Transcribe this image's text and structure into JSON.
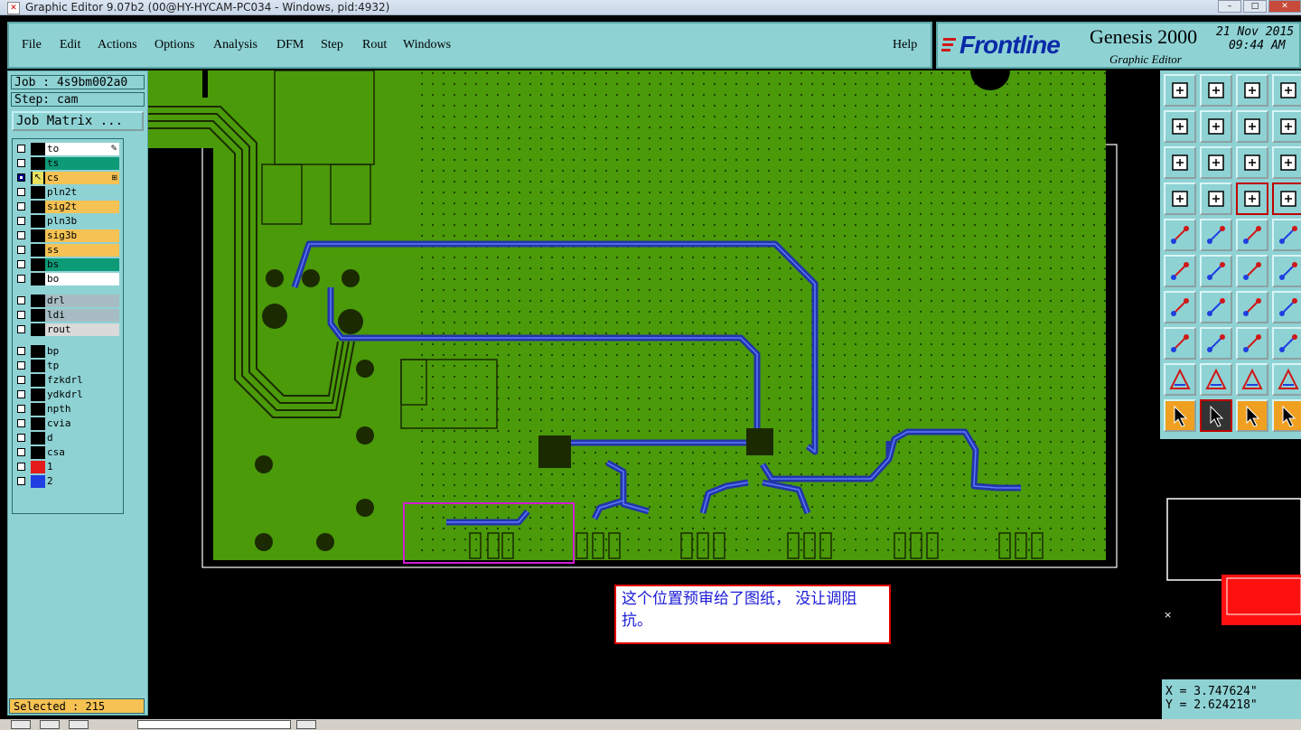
{
  "window": {
    "title": "Graphic Editor 9.07b2 (00@HY-HYCAM-PC034 - Windows, pid:4932)"
  },
  "menu": {
    "items": [
      "File",
      "Edit",
      "Actions",
      "Options",
      "Analysis",
      "DFM",
      "Step",
      "Rout",
      "Windows"
    ],
    "help": "Help"
  },
  "branding": {
    "logo": "Frontline",
    "product": "Genesis 2000",
    "subtitle": "Graphic Editor",
    "date": "21 Nov 2015",
    "time": "09:44 AM"
  },
  "job": {
    "job_line": "Job : 4s9bm002a0",
    "step_line": "Step: cam",
    "matrix_button": "Job Matrix ..."
  },
  "layers": [
    {
      "name": "to",
      "color": "#ffffff",
      "swatch": "#000000",
      "affected": false,
      "marker": "pencil"
    },
    {
      "name": "ts",
      "color": "#0d9a77",
      "swatch": "#000000",
      "affected": false
    },
    {
      "name": "cs",
      "color": "#f5c253",
      "swatch": "#000000",
      "affected": true,
      "marker": "arrow"
    },
    {
      "name": "pln2t",
      "color": "#8ed2d4",
      "swatch": "#000000",
      "affected": false
    },
    {
      "name": "sig2t",
      "color": "#f5c253",
      "swatch": "#000000",
      "affected": false
    },
    {
      "name": "pln3b",
      "color": "#8ed2d4",
      "swatch": "#000000",
      "affected": false
    },
    {
      "name": "sig3b",
      "color": "#f5c253",
      "swatch": "#000000",
      "affected": false
    },
    {
      "name": "ss",
      "color": "#f5c253",
      "swatch": "#000000",
      "affected": false
    },
    {
      "name": "bs",
      "color": "#0d9a77",
      "swatch": "#000000",
      "affected": false
    },
    {
      "name": "bo",
      "color": "#ffffff",
      "swatch": "#000000",
      "affected": false
    },
    {
      "name": "drl",
      "color": "#a7bcc2",
      "swatch": "#000000",
      "affected": false
    },
    {
      "name": "ldi",
      "color": "#a7bcc2",
      "swatch": "#000000",
      "affected": false
    },
    {
      "name": "rout",
      "color": "#dadada",
      "swatch": "#000000",
      "affected": false
    },
    {
      "name": "bp",
      "color": "#8ed2d4",
      "swatch": "#000000",
      "affected": false
    },
    {
      "name": "tp",
      "color": "#8ed2d4",
      "swatch": "#000000",
      "affected": false
    },
    {
      "name": "fzkdrl",
      "color": "#8ed2d4",
      "swatch": "#000000",
      "affected": false
    },
    {
      "name": "ydkdrl",
      "color": "#8ed2d4",
      "swatch": "#000000",
      "affected": false
    },
    {
      "name": "npth",
      "color": "#8ed2d4",
      "swatch": "#000000",
      "affected": false
    },
    {
      "name": "cvia",
      "color": "#8ed2d4",
      "swatch": "#000000",
      "affected": false
    },
    {
      "name": "d",
      "color": "#8ed2d4",
      "swatch": "#000000",
      "affected": false
    },
    {
      "name": "csa",
      "color": "#8ed2d4",
      "swatch": "#000000",
      "affected": false
    },
    {
      "name": "1",
      "color": "#8ed2d4",
      "swatch": "#e41b1b",
      "affected": false
    },
    {
      "name": "2",
      "color": "#8ed2d4",
      "swatch": "#1f3fe0",
      "affected": false
    }
  ],
  "status": {
    "selected": "Selected : 215"
  },
  "annotation": {
    "text": "这个位置预审给了图纸， 没让调阻抗。"
  },
  "coords": {
    "x": "X = 3.747624\"",
    "y": "Y = 2.624218\""
  },
  "colors": {
    "board_green": "#4a9a0a",
    "trace_blue": "#3a56d8",
    "panel_cyan": "#8ed2d4",
    "highlight_magenta": "#d21cd2"
  },
  "toolbox_icons": [
    "zoom-home-icon",
    "zoom-window-icon",
    "house-icon",
    "grid-frame-icon",
    "pan-left-icon",
    "pan-right-icon",
    "undo-redo-icon",
    "snake-icon",
    "fit-all-icon",
    "center-icon",
    "scale-1-2-icon",
    "help-query-icon",
    "measure-tool-icon",
    "grid-icon",
    "layers-red-icon",
    "layers-red-2-icon",
    "pad-add-icon",
    "shape-edit-icon",
    "ruler-icon",
    "dot-icon",
    "net-points-icon",
    "cross-icon",
    "point-to-point-icon",
    "point-blue-icon",
    "line-red-icon",
    "line-blue-icon",
    "arc-icon",
    "text-icon",
    "move-icon",
    "minus-icon",
    "resize-icon",
    "copy-icon",
    "triangle-red-icon",
    "triangle-icon",
    "polygon-icon",
    "polygon-2-icon",
    "select-arrow-icon",
    "select-arrow-2-icon",
    "select-circle-icon",
    "select-filter-icon"
  ]
}
